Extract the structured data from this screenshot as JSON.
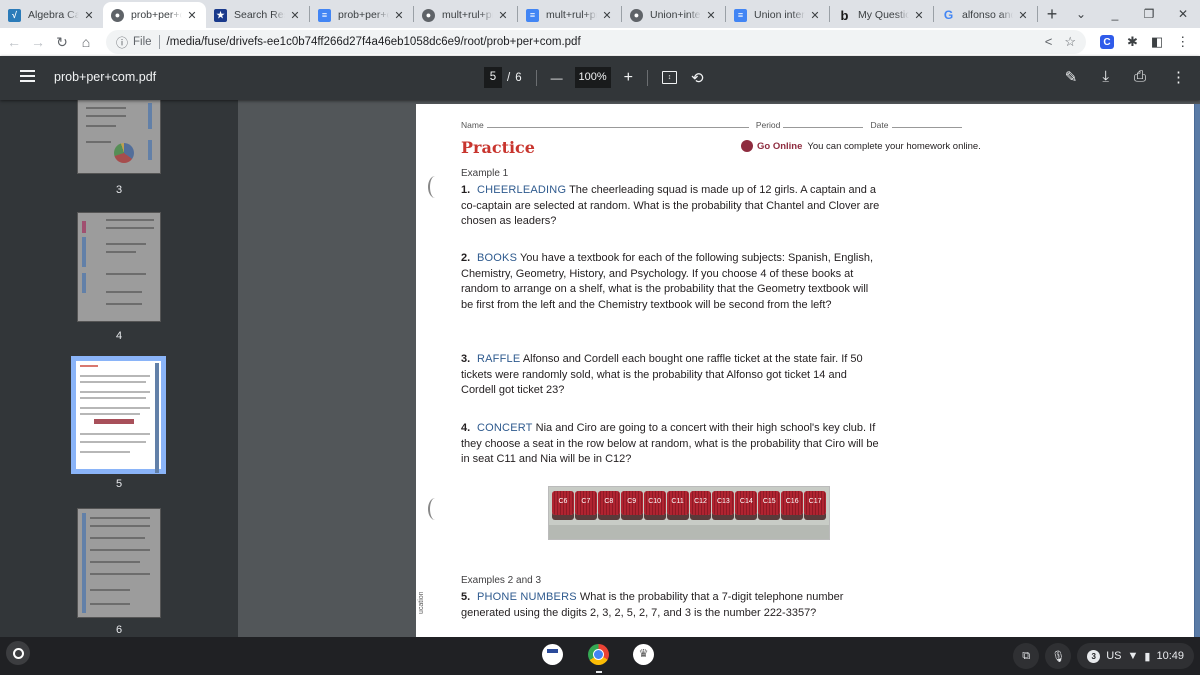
{
  "browser": {
    "tabs": [
      {
        "title": "Algebra Calc",
        "icon": "algebra-calc-icon",
        "active": false
      },
      {
        "title": "prob+per+com",
        "icon": "globe-icon",
        "active": true
      },
      {
        "title": "Search Results",
        "icon": "shield-icon",
        "active": false
      },
      {
        "title": "prob+per+com",
        "icon": "docs-icon",
        "active": false
      },
      {
        "title": "mult+rul+prob",
        "icon": "globe-icon",
        "active": false
      },
      {
        "title": "mult+rul+prob",
        "icon": "docs-icon",
        "active": false
      },
      {
        "title": "Union+inters",
        "icon": "globe-icon",
        "active": false
      },
      {
        "title": "Union inters",
        "icon": "docs-icon",
        "active": false
      },
      {
        "title": "My Question",
        "icon": "bing-icon",
        "active": false
      },
      {
        "title": "alfonso and",
        "icon": "google-icon",
        "active": false
      }
    ],
    "tab_close_glyph": "✕",
    "new_tab_glyph": "+",
    "address": {
      "info_glyph": "ⓘ",
      "scheme_label": "File",
      "url": "/media/fuse/drivefs-ee1c0b74ff266d27f4a46eb1058dc6e9/root/prob+per+com.pdf"
    },
    "extension_label": "C"
  },
  "pdf_viewer": {
    "file_name": "prob+per+com.pdf",
    "current_page": "5",
    "page_separator": "/",
    "total_pages": "6",
    "zoom_level": "100%",
    "zoom_out_glyph": "—",
    "zoom_in_glyph": "+",
    "thumbnails": [
      {
        "page_label": "3",
        "selected": false
      },
      {
        "page_label": "4",
        "selected": false
      },
      {
        "page_label": "5",
        "selected": true
      },
      {
        "page_label": "6",
        "selected": false
      }
    ]
  },
  "document": {
    "name_label": "Name",
    "period_label": "Period",
    "date_label": "Date",
    "heading": "Practice",
    "go_online_label": "Go Online",
    "go_online_text": "You can complete your homework online.",
    "sections": [
      {
        "label": "Example 1"
      },
      {
        "label": "Examples 2 and 3"
      }
    ],
    "questions": [
      {
        "number": "1.",
        "keyword": "CHEERLEADING",
        "text": "The cheerleading squad is made up of 12 girls. A captain and a co-captain are selected at random. What is the probability that Chantel and Clover are chosen as leaders?"
      },
      {
        "number": "2.",
        "keyword": "BOOKS",
        "text": "You have a textbook for each of the following subjects: Spanish, English, Chemistry, Geometry, History, and Psychology. If you choose 4 of these books at random to arrange on a shelf, what is the probability that the Geometry textbook will be first from the left and the Chemistry textbook will be second from the left?"
      },
      {
        "number": "3.",
        "keyword": "RAFFLE",
        "text": "Alfonso and Cordell each bought one raffle ticket at the state fair. If 50 tickets were randomly sold, what is the probability that Alfonso got ticket 14 and Cordell got ticket 23?"
      },
      {
        "number": "4.",
        "keyword": "CONCERT",
        "text": "Nia and Ciro are going to a concert with their high school's key club. If they choose a seat in the row below at random, what is the probability that Ciro will be in seat C11 and Nia will be in C12?"
      },
      {
        "number": "5.",
        "keyword": "PHONE NUMBERS",
        "text": "What is the probability that a 7-digit telephone number generated using the digits 2, 3, 2, 5, 2, 7, and 3 is the number 222-3357?"
      }
    ],
    "seats": [
      "C6",
      "C7",
      "C8",
      "C9",
      "C10",
      "C11",
      "C12",
      "C13",
      "C14",
      "C15",
      "C16",
      "C17"
    ],
    "margin_text": "ucation"
  },
  "shelf": {
    "keyboard_layout": "US",
    "notification_count": "3",
    "time": "10:49"
  },
  "colors": {
    "heading_red": "#c8352e",
    "keyword_blue": "#2e5a8e",
    "go_online": "#8e2c3f",
    "selected_thumb": "#8ab4f8"
  }
}
